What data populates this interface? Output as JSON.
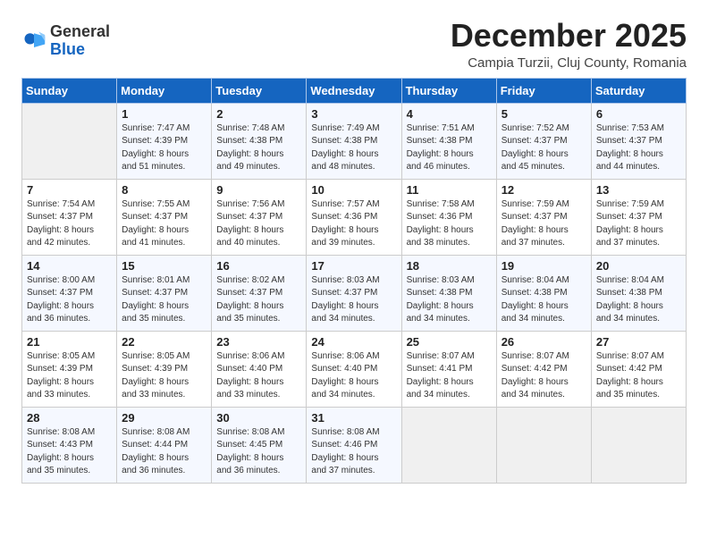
{
  "logo": {
    "general": "General",
    "blue": "Blue"
  },
  "header": {
    "month": "December 2025",
    "location": "Campia Turzii, Cluj County, Romania"
  },
  "weekdays": [
    "Sunday",
    "Monday",
    "Tuesday",
    "Wednesday",
    "Thursday",
    "Friday",
    "Saturday"
  ],
  "weeks": [
    [
      {
        "day": "",
        "info": ""
      },
      {
        "day": "1",
        "info": "Sunrise: 7:47 AM\nSunset: 4:39 PM\nDaylight: 8 hours\nand 51 minutes."
      },
      {
        "day": "2",
        "info": "Sunrise: 7:48 AM\nSunset: 4:38 PM\nDaylight: 8 hours\nand 49 minutes."
      },
      {
        "day": "3",
        "info": "Sunrise: 7:49 AM\nSunset: 4:38 PM\nDaylight: 8 hours\nand 48 minutes."
      },
      {
        "day": "4",
        "info": "Sunrise: 7:51 AM\nSunset: 4:38 PM\nDaylight: 8 hours\nand 46 minutes."
      },
      {
        "day": "5",
        "info": "Sunrise: 7:52 AM\nSunset: 4:37 PM\nDaylight: 8 hours\nand 45 minutes."
      },
      {
        "day": "6",
        "info": "Sunrise: 7:53 AM\nSunset: 4:37 PM\nDaylight: 8 hours\nand 44 minutes."
      }
    ],
    [
      {
        "day": "7",
        "info": "Sunrise: 7:54 AM\nSunset: 4:37 PM\nDaylight: 8 hours\nand 42 minutes."
      },
      {
        "day": "8",
        "info": "Sunrise: 7:55 AM\nSunset: 4:37 PM\nDaylight: 8 hours\nand 41 minutes."
      },
      {
        "day": "9",
        "info": "Sunrise: 7:56 AM\nSunset: 4:37 PM\nDaylight: 8 hours\nand 40 minutes."
      },
      {
        "day": "10",
        "info": "Sunrise: 7:57 AM\nSunset: 4:36 PM\nDaylight: 8 hours\nand 39 minutes."
      },
      {
        "day": "11",
        "info": "Sunrise: 7:58 AM\nSunset: 4:36 PM\nDaylight: 8 hours\nand 38 minutes."
      },
      {
        "day": "12",
        "info": "Sunrise: 7:59 AM\nSunset: 4:37 PM\nDaylight: 8 hours\nand 37 minutes."
      },
      {
        "day": "13",
        "info": "Sunrise: 7:59 AM\nSunset: 4:37 PM\nDaylight: 8 hours\nand 37 minutes."
      }
    ],
    [
      {
        "day": "14",
        "info": "Sunrise: 8:00 AM\nSunset: 4:37 PM\nDaylight: 8 hours\nand 36 minutes."
      },
      {
        "day": "15",
        "info": "Sunrise: 8:01 AM\nSunset: 4:37 PM\nDaylight: 8 hours\nand 35 minutes."
      },
      {
        "day": "16",
        "info": "Sunrise: 8:02 AM\nSunset: 4:37 PM\nDaylight: 8 hours\nand 35 minutes."
      },
      {
        "day": "17",
        "info": "Sunrise: 8:03 AM\nSunset: 4:37 PM\nDaylight: 8 hours\nand 34 minutes."
      },
      {
        "day": "18",
        "info": "Sunrise: 8:03 AM\nSunset: 4:38 PM\nDaylight: 8 hours\nand 34 minutes."
      },
      {
        "day": "19",
        "info": "Sunrise: 8:04 AM\nSunset: 4:38 PM\nDaylight: 8 hours\nand 34 minutes."
      },
      {
        "day": "20",
        "info": "Sunrise: 8:04 AM\nSunset: 4:38 PM\nDaylight: 8 hours\nand 34 minutes."
      }
    ],
    [
      {
        "day": "21",
        "info": "Sunrise: 8:05 AM\nSunset: 4:39 PM\nDaylight: 8 hours\nand 33 minutes."
      },
      {
        "day": "22",
        "info": "Sunrise: 8:05 AM\nSunset: 4:39 PM\nDaylight: 8 hours\nand 33 minutes."
      },
      {
        "day": "23",
        "info": "Sunrise: 8:06 AM\nSunset: 4:40 PM\nDaylight: 8 hours\nand 33 minutes."
      },
      {
        "day": "24",
        "info": "Sunrise: 8:06 AM\nSunset: 4:40 PM\nDaylight: 8 hours\nand 34 minutes."
      },
      {
        "day": "25",
        "info": "Sunrise: 8:07 AM\nSunset: 4:41 PM\nDaylight: 8 hours\nand 34 minutes."
      },
      {
        "day": "26",
        "info": "Sunrise: 8:07 AM\nSunset: 4:42 PM\nDaylight: 8 hours\nand 34 minutes."
      },
      {
        "day": "27",
        "info": "Sunrise: 8:07 AM\nSunset: 4:42 PM\nDaylight: 8 hours\nand 35 minutes."
      }
    ],
    [
      {
        "day": "28",
        "info": "Sunrise: 8:08 AM\nSunset: 4:43 PM\nDaylight: 8 hours\nand 35 minutes."
      },
      {
        "day": "29",
        "info": "Sunrise: 8:08 AM\nSunset: 4:44 PM\nDaylight: 8 hours\nand 36 minutes."
      },
      {
        "day": "30",
        "info": "Sunrise: 8:08 AM\nSunset: 4:45 PM\nDaylight: 8 hours\nand 36 minutes."
      },
      {
        "day": "31",
        "info": "Sunrise: 8:08 AM\nSunset: 4:46 PM\nDaylight: 8 hours\nand 37 minutes."
      },
      {
        "day": "",
        "info": ""
      },
      {
        "day": "",
        "info": ""
      },
      {
        "day": "",
        "info": ""
      }
    ]
  ]
}
